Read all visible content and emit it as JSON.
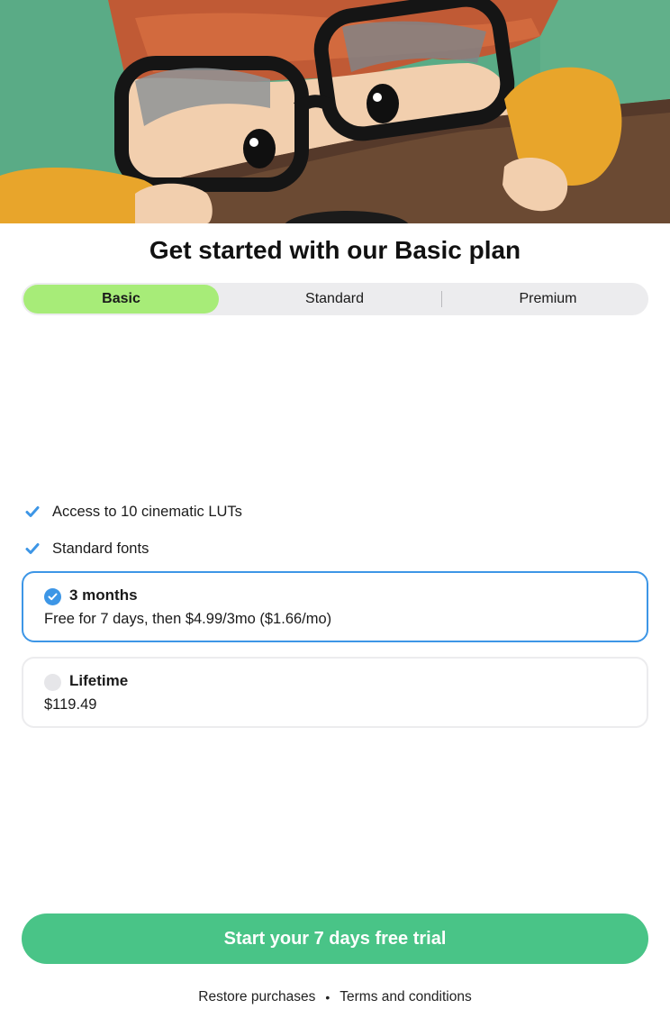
{
  "hero": {
    "alt": "Illustrated child with glasses peeking over a table"
  },
  "title": "Get started with our Basic plan",
  "tabs": [
    {
      "label": "Basic",
      "selected": true
    },
    {
      "label": "Standard",
      "selected": false
    },
    {
      "label": "Premium",
      "selected": false
    }
  ],
  "features": [
    {
      "label": "Access to 10 cinematic LUTs",
      "icon": "checkmark-icon"
    },
    {
      "label": "Standard fonts",
      "icon": "checkmark-icon"
    }
  ],
  "plans": [
    {
      "name": "3 months",
      "description": "Free for 7 days, then $4.99/3mo ($1.66/mo)",
      "selected": true
    },
    {
      "name": "Lifetime",
      "description": "$119.49",
      "selected": false
    }
  ],
  "cta": {
    "label": "Start your 7 days free trial"
  },
  "footer": {
    "restore": "Restore purchases",
    "separator": "•",
    "terms": "Terms and conditions"
  },
  "colors": {
    "accent": "#a7ec78",
    "blue": "#3d96e6",
    "green": "#49c487",
    "segment_bg": "#ececee"
  }
}
